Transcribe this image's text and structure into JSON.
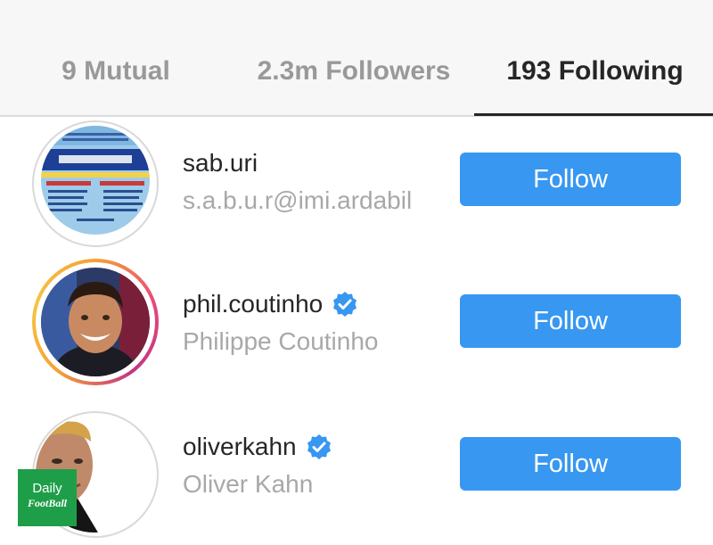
{
  "tabs": {
    "mutual": "9 Mutual",
    "followers": "2.3m Followers",
    "following": "193 Following",
    "active": "following"
  },
  "accounts": [
    {
      "username": "sab.uri",
      "fullname": "s.a.b.u.r@imi.ardabil",
      "verified": false,
      "follow_label": "Follow",
      "avatar": "poster-image"
    },
    {
      "username": "phil.coutinho",
      "fullname": "Philippe Coutinho",
      "verified": true,
      "follow_label": "Follow",
      "avatar": "portrait-photo",
      "has_story_ring": true
    },
    {
      "username": "oliverkahn",
      "fullname": "Oliver Kahn",
      "verified": true,
      "follow_label": "Follow",
      "avatar": "portrait-photo"
    }
  ],
  "watermark": {
    "line1": "Daily",
    "line2": "FootBall"
  },
  "colors": {
    "follow_button": "#3897f0",
    "verified_badge": "#3897f0",
    "watermark_bg": "#1f9e4a",
    "active_tab_text": "#262626",
    "inactive_tab_text": "#999999"
  }
}
